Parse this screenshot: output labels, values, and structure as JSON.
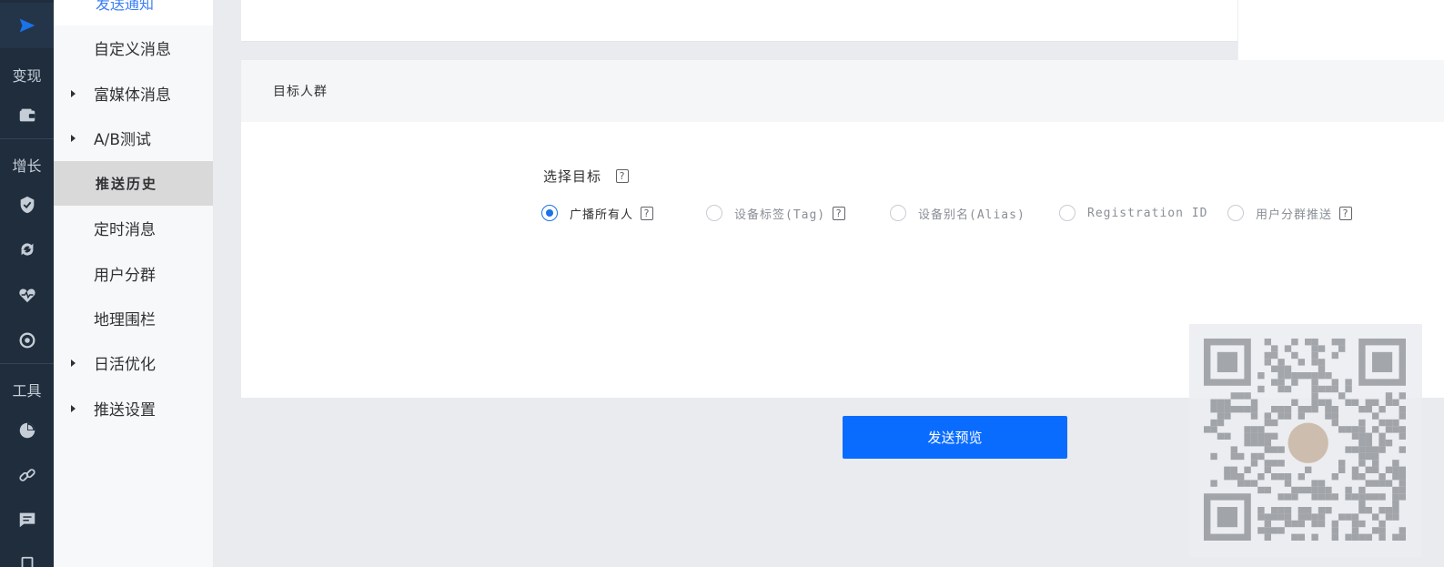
{
  "rail": {
    "labels": [
      "变现",
      "增长",
      "工具"
    ],
    "icons": [
      "send-icon",
      "wallet-icon",
      "shield-icon",
      "sync-icon",
      "heartbeat-icon",
      "target-icon",
      "pie-chart-icon",
      "link-icon",
      "chat-icon",
      "document-icon"
    ]
  },
  "submenu": {
    "breadcrumb": "发送通知",
    "items": [
      {
        "label": "自定义消息",
        "expandable": false
      },
      {
        "label": "富媒体消息",
        "expandable": true
      },
      {
        "label": "A/B测试",
        "expandable": true
      },
      {
        "label": "推送历史",
        "expandable": false,
        "selected": true
      },
      {
        "label": "定时消息",
        "expandable": false
      },
      {
        "label": "用户分群",
        "expandable": false
      },
      {
        "label": "地理围栏",
        "expandable": false
      },
      {
        "label": "日活优化",
        "expandable": true
      },
      {
        "label": "推送设置",
        "expandable": true
      }
    ]
  },
  "target_section": {
    "title": "目标人群",
    "field_label": "选择目标",
    "options": [
      {
        "label": "广播所有人",
        "checked": true,
        "help": true
      },
      {
        "label": "设备标签(Tag)",
        "checked": false,
        "help": true
      },
      {
        "label": "设备别名(Alias)",
        "checked": false,
        "help": false
      },
      {
        "label": "Registration ID",
        "checked": false,
        "help": false
      },
      {
        "label": "用户分群推送",
        "checked": false,
        "help": true
      }
    ]
  },
  "help_glyph": "?",
  "actions": {
    "send_preview": "发送预览"
  },
  "colors": {
    "rail_bg": "#1f2d3d",
    "accent": "#0a6cff",
    "radio_checked": "#1a73e8"
  }
}
